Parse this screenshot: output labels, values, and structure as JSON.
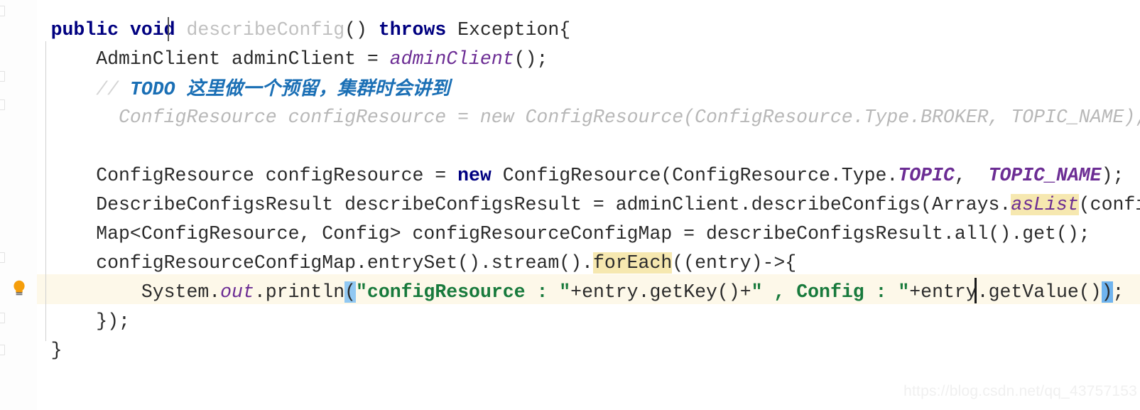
{
  "editor": {
    "app": "intellij-idea-java-editor",
    "language": "Java",
    "current_line_number": 10,
    "colors": {
      "background": "#ffffff",
      "keyword": "#000080",
      "string": "#187a3c",
      "static_field": "#6c2d94",
      "comment": "#d4d4d4",
      "todo": "#1a6fb5",
      "search_highlight": "#f6e8b0",
      "bracket_match": "#91c8f2",
      "current_line": "#fdf8e9",
      "caret": "#1a1a1a"
    }
  },
  "gutter": {
    "intention_icon": "lightbulb-icon",
    "intention_tooltip": "Show Context Actions"
  },
  "code": {
    "lines": [
      {
        "id": "line-1",
        "text": "public void describeConfig() throws Exception{",
        "segments": [
          {
            "t": "    ",
            "c": "plain"
          },
          {
            "t": "public void ",
            "c": "kw"
          },
          {
            "t": "describeConfig",
            "c": "ghost"
          },
          {
            "t": "() ",
            "c": "plain"
          },
          {
            "t": "throws",
            "c": "kw"
          },
          {
            "t": " Exception{",
            "c": "plain"
          }
        ]
      },
      {
        "id": "line-2",
        "text": "AdminClient adminClient = adminClient();",
        "segments": [
          {
            "t": "        AdminClient adminClient = ",
            "c": "plain"
          },
          {
            "t": "adminClient",
            "c": "stat"
          },
          {
            "t": "();",
            "c": "plain"
          }
        ]
      },
      {
        "id": "line-3",
        "text": "// TODO 这里做一个预留，集群时会讲到",
        "segments": [
          {
            "t": "        ",
            "c": "plain"
          },
          {
            "t": "// ",
            "c": "cmt"
          },
          {
            "t": "TODO ",
            "c": "cmt-txt"
          },
          {
            "t": "这里做一个预留，集群时会讲到",
            "c": "cmt-txt cjk"
          }
        ]
      },
      {
        "id": "line-4",
        "text": "//    ConfigResource configResource = new ConfigResource(ConfigResource.Type.BROKER, TOPIC_NAME);",
        "segments": [
          {
            "t": "          ConfigResource configResource = new ConfigResource(ConfigResource.Type.BROKER, TOPIC_NAME);",
            "c": "cmt-dim"
          }
        ]
      },
      {
        "id": "line-5",
        "text": "",
        "segments": []
      },
      {
        "id": "line-6",
        "text": "ConfigResource configResource = new ConfigResource(ConfigResource.Type.TOPIC, TOPIC_NAME);",
        "segments": [
          {
            "t": "        ConfigResource configResource = ",
            "c": "plain"
          },
          {
            "t": "new",
            "c": "kw"
          },
          {
            "t": " ConfigResource(ConfigResource.Type.",
            "c": "plain"
          },
          {
            "t": "TOPIC",
            "c": "field"
          },
          {
            "t": ",  ",
            "c": "plain"
          },
          {
            "t": "TOPIC_NAME",
            "c": "field"
          },
          {
            "t": ");",
            "c": "plain"
          }
        ]
      },
      {
        "id": "line-7",
        "text": "DescribeConfigsResult describeConfigsResult = adminClient.describeConfigs(Arrays.asList(configResource));",
        "segments": [
          {
            "t": "        DescribeConfigsResult describeConfigsResult = adminClient.describeConfigs(Arrays.",
            "c": "plain"
          },
          {
            "t": "asList",
            "c": "stat hl"
          },
          {
            "t": "(configResource));",
            "c": "plain"
          }
        ]
      },
      {
        "id": "line-8",
        "text": "Map<ConfigResource, Config> configResourceConfigMap = describeConfigsResult.all().get();",
        "segments": [
          {
            "t": "        Map<ConfigResource, Config> configResourceConfigMap = describeConfigsResult.all().get();",
            "c": "plain"
          }
        ]
      },
      {
        "id": "line-9",
        "text": "configResourceConfigMap.entrySet().stream().forEach((entry)->{",
        "segments": [
          {
            "t": "        configResourceConfigMap.entrySet().stream().",
            "c": "plain"
          },
          {
            "t": "forEach",
            "c": "plain hl"
          },
          {
            "t": "((entry)->{",
            "c": "plain"
          }
        ]
      },
      {
        "id": "line-10",
        "text": "System.out.println(\"configResource : \"+entry.getKey()+\" , Config : \"+entry.getValue());",
        "current": true,
        "segments": [
          {
            "t": "            System.",
            "c": "plain"
          },
          {
            "t": "out",
            "c": "stat"
          },
          {
            "t": ".println",
            "c": "plain"
          },
          {
            "t": "(",
            "c": "plain brk"
          },
          {
            "t": "\"configResource : \"",
            "c": "str"
          },
          {
            "t": "+entry.getKey()+",
            "c": "plain"
          },
          {
            "t": "\" , Config : \"",
            "c": "str"
          },
          {
            "t": "+entry.getValue()",
            "c": "plain"
          },
          {
            "t": ")",
            "c": "plain brk2"
          },
          {
            "t": ";",
            "c": "plain"
          }
        ]
      },
      {
        "id": "line-11",
        "text": "});",
        "segments": [
          {
            "t": "        });",
            "c": "plain"
          }
        ]
      },
      {
        "id": "line-12",
        "text": "}",
        "segments": [
          {
            "t": "    }",
            "c": "plain"
          }
        ]
      }
    ]
  },
  "watermark": {
    "text": "https://blog.csdn.net/qq_43757153"
  }
}
